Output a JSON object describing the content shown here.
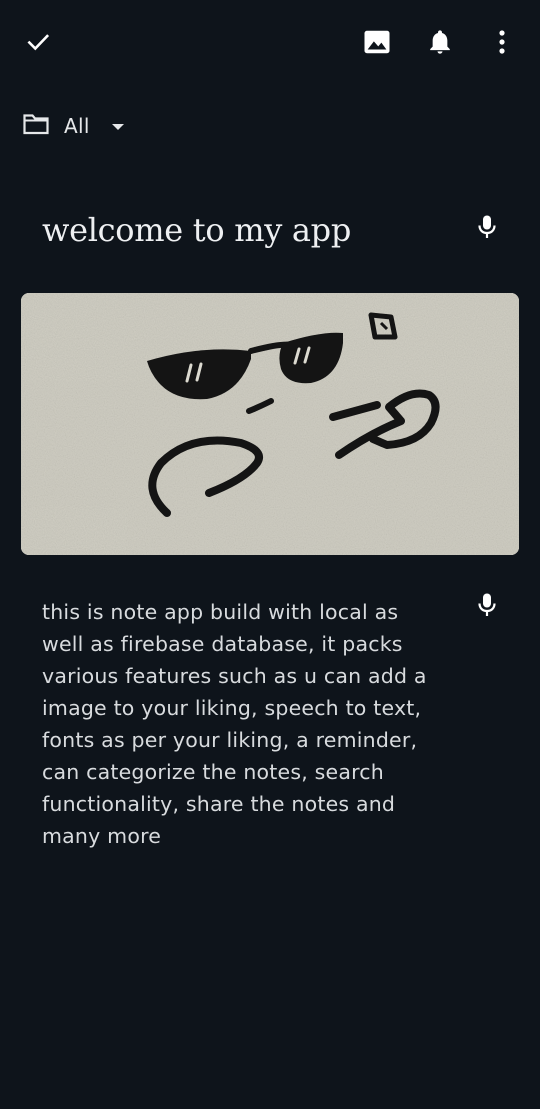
{
  "toolbar": {
    "done_icon": "check-icon",
    "image_icon": "image-icon",
    "reminder_icon": "bell-icon",
    "more_icon": "more-vert-icon"
  },
  "folder": {
    "icon": "folder-icon",
    "selected": "All",
    "dropdown_icon": "caret-down-icon"
  },
  "note": {
    "title": "welcome to my app",
    "title_mic_icon": "mic-icon",
    "image_description_icon": "sketch-image",
    "body": "this is note app build with local as\nwell as firebase database, it packs\nvarious features such as u can add a\nimage to your liking, speech to text,\nfonts as per your liking, a reminder,\ncan categorize the notes, search\nfunctionality, share the notes and\nmany more",
    "body_mic_icon": "mic-icon"
  },
  "colors": {
    "background": "#0e141b",
    "text": "#e6e8ea",
    "icon": "#ffffff"
  }
}
